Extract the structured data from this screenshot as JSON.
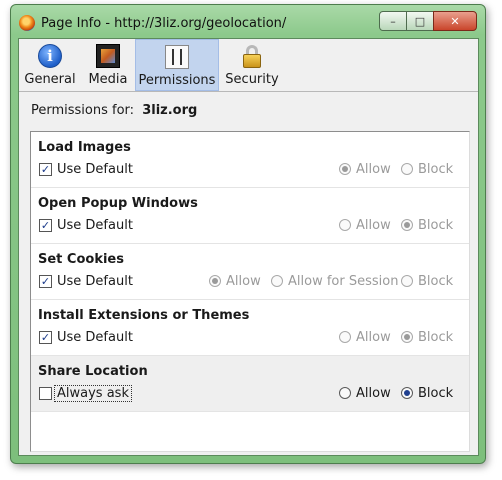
{
  "window": {
    "title": "Page Info - http://3liz.org/geolocation/"
  },
  "caption": {
    "minimize": "–",
    "maximize": "□",
    "close": "✕"
  },
  "tabs": [
    {
      "label": "General",
      "icon": "info-icon"
    },
    {
      "label": "Media",
      "icon": "media-icon"
    },
    {
      "label": "Permissions",
      "icon": "permissions-icon",
      "selected": true
    },
    {
      "label": "Security",
      "icon": "lock-icon"
    }
  ],
  "permissions_for": {
    "label": "Permissions for:",
    "site": "3liz.org"
  },
  "sections": [
    {
      "title": "Load Images",
      "checkbox_label": "Use Default",
      "checked": true,
      "options": [
        "Allow",
        "Block"
      ],
      "selected": "Allow",
      "enabled": false
    },
    {
      "title": "Open Popup Windows",
      "checkbox_label": "Use Default",
      "checked": true,
      "options": [
        "Allow",
        "Block"
      ],
      "selected": "Block",
      "enabled": false
    },
    {
      "title": "Set Cookies",
      "checkbox_label": "Use Default",
      "checked": true,
      "options": [
        "Allow",
        "Allow for Session",
        "Block"
      ],
      "selected": "Allow",
      "enabled": false
    },
    {
      "title": "Install Extensions or Themes",
      "checkbox_label": "Use Default",
      "checked": true,
      "options": [
        "Allow",
        "Block"
      ],
      "selected": "Block",
      "enabled": false
    },
    {
      "title": "Share Location",
      "checkbox_label": "Always ask",
      "checked": false,
      "options": [
        "Allow",
        "Block"
      ],
      "selected": "Block",
      "enabled": true
    }
  ],
  "colors": {
    "window_frame": "#8cc98b",
    "selected_tab": "#c2d4ee"
  }
}
